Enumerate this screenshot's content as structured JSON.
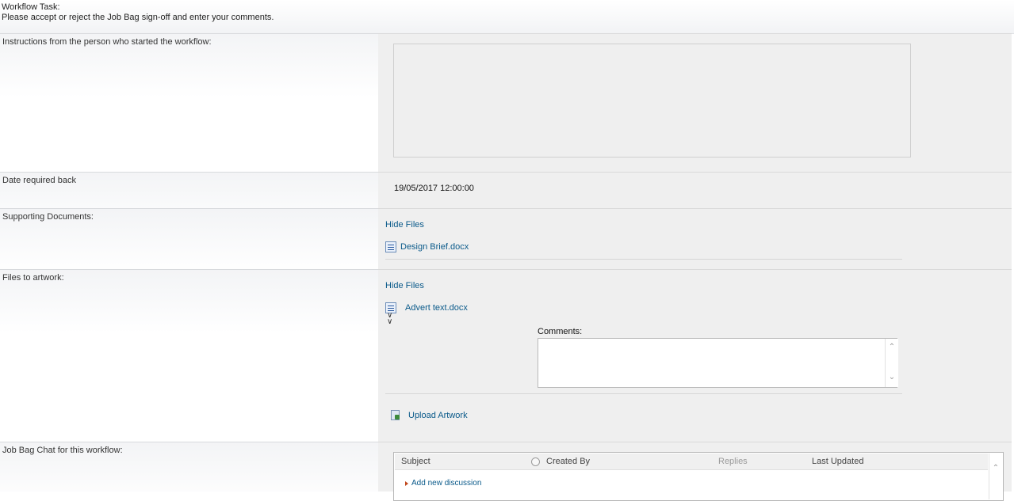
{
  "header": {
    "title": "Workflow Task:",
    "subtitle": "Please accept or reject the Job Bag sign-off and enter your comments."
  },
  "rows": {
    "instructions": {
      "label": "Instructions from the person who started the workflow:"
    },
    "date": {
      "label": "Date required back",
      "value": "19/05/2017 12:00:00"
    },
    "supporting": {
      "label": "Supporting Documents:",
      "toggle": "Hide Files",
      "files": [
        "Design Brief.docx"
      ]
    },
    "artwork": {
      "label": "Files to artwork:",
      "toggle": "Hide Files",
      "files": [
        "Advert text.docx"
      ],
      "expand_icon": "double-chevron-down-icon",
      "comments_label": "Comments:",
      "comments_value": "",
      "upload_label": "Upload Artwork"
    },
    "chat": {
      "label": "Job Bag Chat for this workflow:",
      "columns": [
        "Subject",
        "Created By",
        "Replies",
        "Last Updated"
      ],
      "add_label": "Add new discussion"
    }
  },
  "colors": {
    "link": "#0a5a8a",
    "value_bg": "#efefef",
    "accent_arrow": "#c0461b"
  }
}
